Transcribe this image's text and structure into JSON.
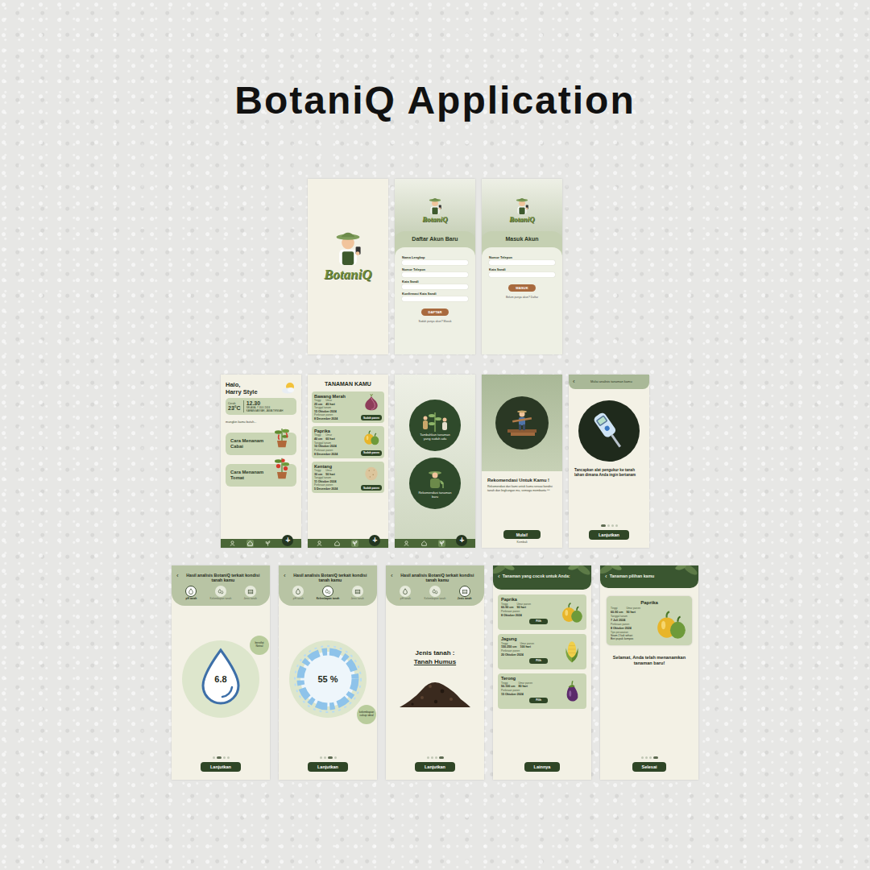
{
  "title": "BotaniQ Application",
  "splash": {
    "logo": "BotaniQ"
  },
  "register": {
    "logo": "BotaniQ",
    "heading": "Daftar Akun Baru",
    "fields": [
      {
        "label": "Nama Lengkap"
      },
      {
        "label": "Nomor Telepon"
      },
      {
        "label": "Kata Sandi"
      },
      {
        "label": "Konfirmasi Kata Sandi"
      }
    ],
    "button": "DAFTAR",
    "footer": "Sudah punya akun? Masuk"
  },
  "login": {
    "logo": "BotaniQ",
    "heading": "Masuk Akun",
    "fields": [
      {
        "label": "Nomor Telepon"
      },
      {
        "label": "Kata Sandi"
      }
    ],
    "button": "MASUK",
    "footer": "Belum punya akun? Daftar"
  },
  "home": {
    "greeting": "Halo,",
    "name": "Harry Style",
    "weather": {
      "condition": "Cerah",
      "temp": "23°C",
      "time": "12.30",
      "date": "SELASA, 7 JULI 2024",
      "place": "KARANGANYAR, JAWA TENGAH"
    },
    "prompt": "mungkin kamu butuh...",
    "guides": [
      {
        "label": "Cara Menanam Cabai",
        "kind": "chili"
      },
      {
        "label": "Cara Menanam Tomat",
        "kind": "tomato"
      }
    ],
    "nav": {
      "items": [
        {
          "kind": "profile",
          "selected": false
        },
        {
          "kind": "home",
          "selected": true
        },
        {
          "kind": "plant",
          "selected": false
        }
      ],
      "add": "+"
    }
  },
  "plants": {
    "heading": "TANAMAN KAMU",
    "items": [
      {
        "name": "Bawang Merah",
        "kind": "onion",
        "stats": [
          {
            "label": "Tinggi",
            "value": "25 cm"
          },
          {
            "label": "Umur",
            "value": "45 hari"
          }
        ],
        "planted_label": "Tanggal tanam",
        "planted": "15 Oktober 2024",
        "harvest_label": "Perkiraan panen",
        "harvest": "8 Desember 2024",
        "button": "Sudah panen"
      },
      {
        "name": "Paprika",
        "kind": "paprika",
        "stats": [
          {
            "label": "Tinggi",
            "value": "40 cm"
          },
          {
            "label": "Umur",
            "value": "60 hari"
          }
        ],
        "planted_label": "Tanggal tanam",
        "planted": "10 Oktober 2024",
        "harvest_label": "Perkiraan panen",
        "harvest": "8 Desember 2024",
        "button": "Sudah panen"
      },
      {
        "name": "Kentang",
        "kind": "potato",
        "stats": [
          {
            "label": "Tinggi",
            "value": "30 cm"
          },
          {
            "label": "Umur",
            "value": "50 hari"
          }
        ],
        "planted_label": "Tanggal tanam",
        "planted": "11 Oktober 2024",
        "harvest_label": "Perkiraan panen",
        "harvest": "5 Desember 2024",
        "button": "Sudah panen"
      }
    ],
    "nav": {
      "items": [
        {
          "kind": "profile",
          "selected": false
        },
        {
          "kind": "home",
          "selected": false
        },
        {
          "kind": "plant",
          "selected": true
        }
      ],
      "add": "+"
    }
  },
  "add_menu": {
    "options": [
      {
        "label": "Tambahkan tanaman yang sudah ada",
        "kind": "existing"
      },
      {
        "label": "Rekomendasi tanaman baru",
        "kind": "new"
      }
    ],
    "nav": {
      "items": [
        {
          "kind": "profile",
          "selected": false
        },
        {
          "kind": "home",
          "selected": false
        },
        {
          "kind": "plant",
          "selected": true
        }
      ],
      "add": "+"
    }
  },
  "recommend": {
    "heading": "Rekomendasi Untuk Kamu !",
    "text": "Rekomendasi dari kami untuk kamu sesuai kondisi tanah dan lingkungan mu, semoga membantu ^^",
    "button": "Mulai!",
    "back": "Kembali"
  },
  "analyze_start": {
    "back": "‹",
    "heading": "Mulai analisis tanaman kamu",
    "instruction": "Tancapkan alat pengukur ke tanah lahan dimana Anda ingin bertanam",
    "dots": [
      {
        "selected": true
      },
      {
        "selected": false
      },
      {
        "selected": false
      },
      {
        "selected": false
      }
    ],
    "button": "Lanjutkan"
  },
  "results": [
    {
      "kind": "ph",
      "back": "‹",
      "heading": "Hasil analisis BotaniQ terkait kondisi tanah kamu",
      "tabs": [
        {
          "label": "pH tanah",
          "kind": "ph",
          "selected": true
        },
        {
          "label": "Kelembapan tanah",
          "kind": "moisture",
          "selected": false
        },
        {
          "label": "Jenis tanah",
          "kind": "soil",
          "selected": false
        }
      ],
      "value": "6.8",
      "badge": "bersifat Netral",
      "dots": [
        {
          "selected": false
        },
        {
          "selected": true
        },
        {
          "selected": false
        },
        {
          "selected": false
        }
      ],
      "button": "Lanjutkan"
    },
    {
      "kind": "moisture",
      "back": "‹",
      "heading": "Hasil analisis BotaniQ terkait kondisi tanah kamu",
      "tabs": [
        {
          "label": "pH tanah",
          "kind": "ph",
          "selected": false
        },
        {
          "label": "Kelembapan tanah",
          "kind": "moisture",
          "selected": true
        },
        {
          "label": "Jenis tanah",
          "kind": "soil",
          "selected": false
        }
      ],
      "value": "55 %",
      "badge": "kelembapan cukup ideal",
      "dots": [
        {
          "selected": false
        },
        {
          "selected": false
        },
        {
          "selected": true
        },
        {
          "selected": false
        }
      ],
      "button": "Lanjutkan"
    },
    {
      "kind": "soil",
      "back": "‹",
      "heading": "Hasil analisis BotaniQ terkait kondisi tanah kamu",
      "tabs": [
        {
          "label": "pH tanah",
          "kind": "ph",
          "selected": false
        },
        {
          "label": "Kelembapan tanah",
          "kind": "moisture",
          "selected": false
        },
        {
          "label": "Jenis tanah",
          "kind": "soil",
          "selected": true
        }
      ],
      "label": "Jenis tanah :",
      "value": "Tanah Humus",
      "dots": [
        {
          "selected": false
        },
        {
          "selected": false
        },
        {
          "selected": false
        },
        {
          "selected": true
        }
      ],
      "button": "Lanjutkan"
    }
  ],
  "suitable": {
    "back": "‹",
    "heading": "Tanaman yang cocok untuk Anda:",
    "items": [
      {
        "name": "Paprika",
        "kind": "paprika",
        "stats": [
          {
            "label": "Tinggi",
            "value": "60-90 cm"
          },
          {
            "label": "Umur panen",
            "value": "90 hari"
          }
        ],
        "harvest_label": "Perkiraan panen",
        "harvest": "8 Oktober 2024",
        "button": "Pilih"
      },
      {
        "name": "Jagung",
        "kind": "corn",
        "stats": [
          {
            "label": "Tinggi",
            "value": "150-250 cm"
          },
          {
            "label": "Umur panen",
            "value": "100 hari"
          }
        ],
        "harvest_label": "Perkiraan panen",
        "harvest": "20 Oktober 2024",
        "button": "Pilih"
      },
      {
        "name": "Terong",
        "kind": "eggplant",
        "stats": [
          {
            "label": "Tinggi",
            "value": "50-100 cm"
          },
          {
            "label": "Umur panen",
            "value": "80 hari"
          }
        ],
        "harvest_label": "Perkiraan panen",
        "harvest": "15 Oktober 2024",
        "button": "Pilih"
      }
    ],
    "more": "Lainnya"
  },
  "chosen": {
    "back": "‹",
    "heading": "Tanaman pilihan kamu",
    "plant": {
      "name": "Paprika",
      "kind": "paprika",
      "stats": [
        {
          "label": "Tinggi",
          "value": "60-90 cm"
        },
        {
          "label": "Umur panen",
          "value": "90 hari"
        }
      ],
      "planted_label": "Tanggal tanam",
      "planted": "7 Juli 2024",
      "harvest_label": "Perkiraan panen",
      "harvest": "8 Oktober 2024",
      "tips_label": "Tips perawatan",
      "tips": [
        "Siram 2 kali sehari",
        "Beri pupuk kompos"
      ]
    },
    "message": "Selamat, Anda telah menanamkan tanaman baru!",
    "dots": [
      {
        "selected": false
      },
      {
        "selected": false
      },
      {
        "selected": false
      },
      {
        "selected": true
      }
    ],
    "button": "Selesai"
  }
}
